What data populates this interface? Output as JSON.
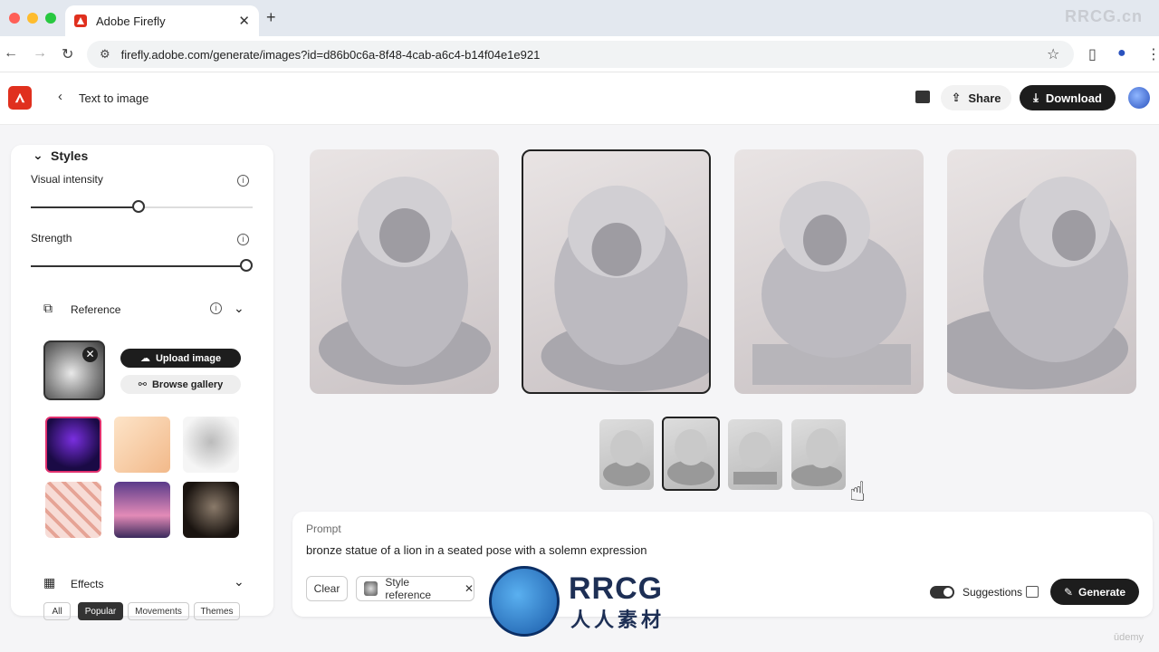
{
  "browser": {
    "tab_title": "Adobe Firefly",
    "url": "firefly.adobe.com/generate/images?id=d86b0c6a-8f48-4cab-a6c4-b14f04e1e921",
    "watermark": "RRCG.cn"
  },
  "header": {
    "back_label": "Text to image",
    "share_label": "Share",
    "download_label": "Download"
  },
  "panel": {
    "styles_title": "Styles",
    "visual_intensity_label": "Visual intensity",
    "visual_intensity_value": 0.5,
    "strength_label": "Strength",
    "strength_value": 1.0,
    "reference_label": "Reference",
    "upload_label": "Upload image",
    "browse_label": "Browse gallery",
    "effects_label": "Effects",
    "effect_chips": [
      "All",
      "Popular",
      "Movements",
      "Themes"
    ],
    "selected_chip": "Popular"
  },
  "gallery": {
    "selected_index": 1,
    "image_count": 4
  },
  "prompt": {
    "label": "Prompt",
    "text": "bronze statue of a lion in a seated pose with a solemn expression",
    "clear_label": "Clear",
    "style_ref_label": "Style reference",
    "suggestions_label": "Suggestions",
    "suggestions_on": true,
    "generate_label": "Generate"
  },
  "overlay": {
    "logo_text": "RRCG",
    "logo_sub": "人人素材",
    "udemy": "ūdemy"
  },
  "colors": {
    "adobe_red": "#e0301e",
    "dark": "#1d1d1d",
    "page_bg": "#f5f5f7"
  }
}
